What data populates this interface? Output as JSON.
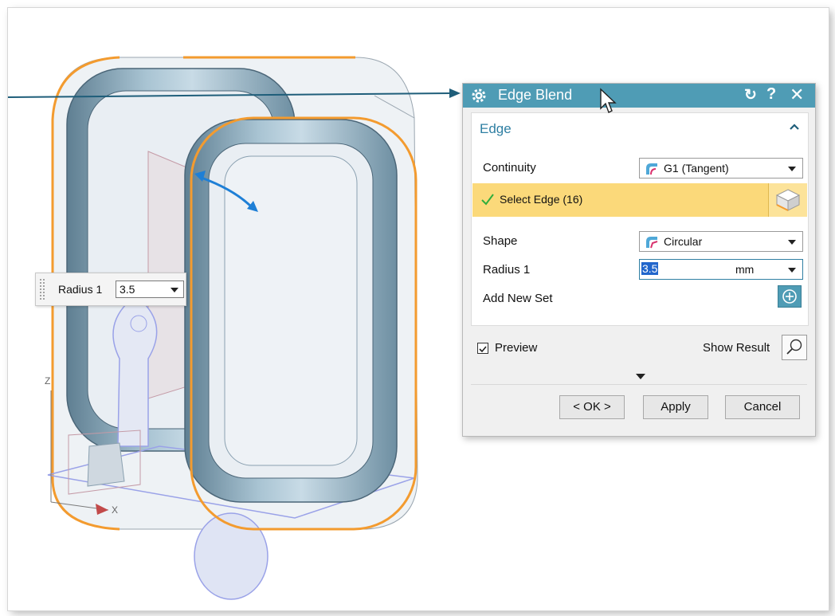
{
  "viewport": {
    "radius_widget": {
      "label": "Radius 1",
      "value": "3.5",
      "grip_icon": "grip-icon",
      "dropdown_icon": "chevron-down-icon"
    },
    "triad_labels": {
      "z": "Z",
      "x": "X"
    }
  },
  "dialog": {
    "title": "Edge Blend",
    "title_icons": {
      "settings": "gear-icon",
      "reset": "reset-icon",
      "help": "?",
      "close": "✕"
    },
    "section": {
      "title": "Edge",
      "collapse_icon": "chevron-up-icon"
    },
    "continuity": {
      "label": "Continuity",
      "value": "G1 (Tangent)",
      "icon": "tangent-blend-icon"
    },
    "select_edge": {
      "label": "Select Edge (16)",
      "status_icon": "checkmark-icon",
      "selector_icon": "cube-icon"
    },
    "shape": {
      "label": "Shape",
      "value": "Circular",
      "icon": "circular-blend-icon"
    },
    "radius": {
      "label": "Radius 1",
      "value": "3.5",
      "unit": "mm"
    },
    "add_new_set": {
      "label": "Add New Set",
      "icon": "plus-circle-icon"
    },
    "preview": {
      "label": "Preview",
      "checked": true
    },
    "show_result": {
      "label": "Show Result",
      "icon": "magnifier-icon"
    },
    "buttons": {
      "ok": "< OK >",
      "apply": "Apply",
      "cancel": "Cancel"
    }
  },
  "colors": {
    "accent": "#4f9cb5",
    "highlight": "#fbd97a",
    "edge_select": "#f39b2f"
  }
}
